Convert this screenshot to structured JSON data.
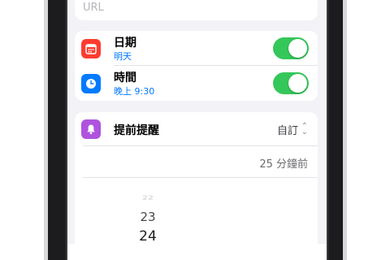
{
  "url_field": {
    "placeholder": "URL"
  },
  "date_row": {
    "label": "日期",
    "value": "明天",
    "toggle_on": true,
    "icon": "calendar-icon",
    "icon_color": "#ff3b30"
  },
  "time_row": {
    "label": "時間",
    "value": "晚上 9:30",
    "toggle_on": true,
    "icon": "clock-icon",
    "icon_color": "#007aff"
  },
  "early_reminder": {
    "label": "提前提醒",
    "value": "自訂",
    "icon": "bell-icon",
    "icon_color": "#af52de"
  },
  "minutes_summary": "25 分鐘前",
  "picker": {
    "items": [
      "22",
      "23",
      "24"
    ]
  },
  "colors": {
    "accent": "#007aff",
    "toggle_on": "#34c759",
    "background": "#f2f2f7"
  }
}
